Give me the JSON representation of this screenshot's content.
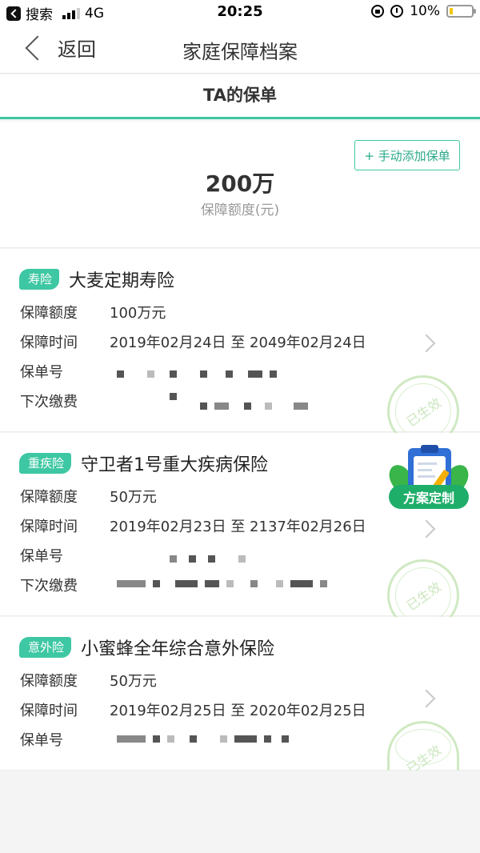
{
  "status_bar": {
    "back_app": "搜索",
    "network": "4G",
    "time": "20:25",
    "battery": "10%"
  },
  "nav": {
    "back_label": "返回",
    "title": "家庭保障档案"
  },
  "tab": {
    "label": "TA的保单"
  },
  "summary": {
    "add_button": "+ 手动添加保单",
    "amount": "200万",
    "amount_label": "保障额度(元)"
  },
  "labels": {
    "coverage": "保障额度",
    "period": "保障时间",
    "policy_no": "保单号",
    "next_payment": "下次缴费",
    "stamp": "已生效"
  },
  "policies": [
    {
      "type": "寿险",
      "name": "大麦定期寿险",
      "coverage": "100万元",
      "period": "2019年02月24日 至 2049年02月24日"
    },
    {
      "type": "重疾险",
      "name": "守卫者1号重大疾病保险",
      "coverage": "50万元",
      "period": "2019年02月23日 至 2137年02月26日"
    },
    {
      "type": "意外险",
      "name": "小蜜蜂全年综合意外保险",
      "coverage": "50万元",
      "period": "2019年02月25日 至 2020年02月25日"
    }
  ],
  "promo": {
    "label": "方案定制"
  },
  "colors": {
    "accent": "#3ec7a3",
    "stamp": "#cfe9c2"
  }
}
